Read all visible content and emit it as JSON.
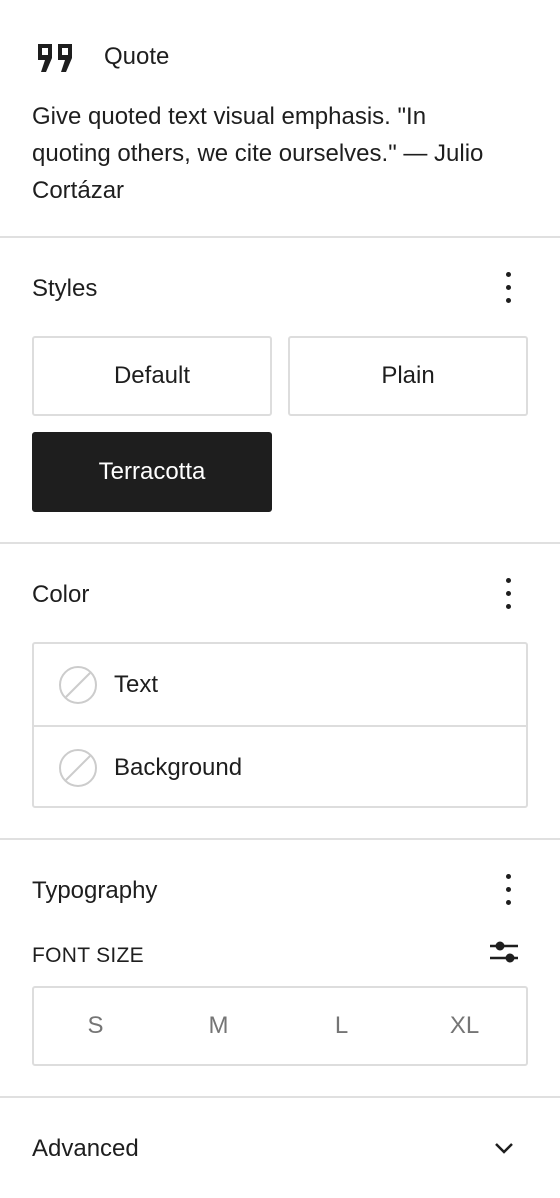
{
  "block": {
    "icon": "quote-icon",
    "title": "Quote",
    "description": "Give quoted text visual emphasis. \"In quoting others, we cite ourselves.\" — Julio Cortázar"
  },
  "styles": {
    "title": "Styles",
    "options": [
      "Default",
      "Plain",
      "Terracotta"
    ],
    "active": "Terracotta"
  },
  "color": {
    "title": "Color",
    "items": [
      "Text",
      "Background"
    ]
  },
  "typography": {
    "title": "Typography",
    "font_size_label": "FONT SIZE",
    "sizes": [
      "S",
      "M",
      "L",
      "XL"
    ]
  },
  "advanced": {
    "title": "Advanced"
  },
  "colors": {
    "text": "#1e1e1e",
    "border": "#dddddd",
    "divider": "#e0e0e0",
    "active_bg": "#1e1e1e",
    "muted": "#757575"
  }
}
